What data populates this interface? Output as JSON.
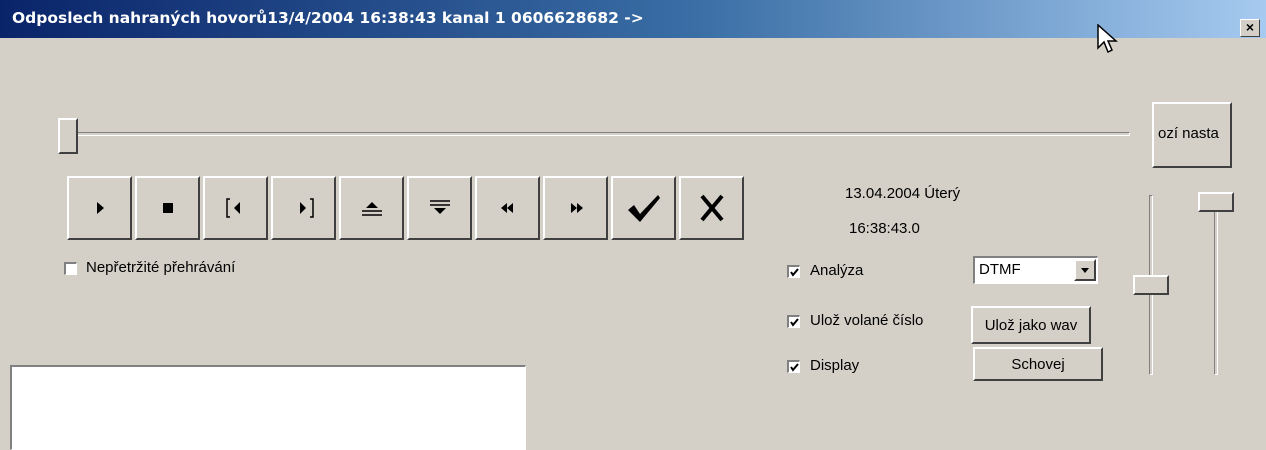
{
  "window": {
    "title": "Odposlech nahraných hovorů13/4/2004 16:38:43 kanal 1 0606628682 ->",
    "close_label": "×"
  },
  "settings_button": {
    "label": "ozí nasta"
  },
  "toolbar": {
    "buttons": [
      {
        "name": "play",
        "icon": "play-icon"
      },
      {
        "name": "stop",
        "icon": "stop-icon"
      },
      {
        "name": "mark-start",
        "icon": "mark-start-icon"
      },
      {
        "name": "mark-end",
        "icon": "mark-end-icon"
      },
      {
        "name": "eject-up",
        "icon": "eject-up-icon"
      },
      {
        "name": "eject-down",
        "icon": "eject-down-icon"
      },
      {
        "name": "rewind",
        "icon": "rewind-icon"
      },
      {
        "name": "fast-forward",
        "icon": "fast-forward-icon"
      },
      {
        "name": "confirm",
        "icon": "checkmark-icon"
      },
      {
        "name": "cancel",
        "icon": "x-icon"
      }
    ]
  },
  "continuous_playback": {
    "label": "Nepřetržité přehrávání",
    "checked": false
  },
  "datetime": {
    "date": "13.04.2004 Úterý",
    "time": "16:38:43.0"
  },
  "options": {
    "analysis": {
      "label": "Analýza",
      "checked": true
    },
    "save_number": {
      "label": "Ulož volané číslo",
      "checked": true
    },
    "display": {
      "label": "Display",
      "checked": true
    }
  },
  "analysis_mode": {
    "value": "DTMF"
  },
  "buttons": {
    "save_wav": "Ulož jako wav",
    "hide": "Schovej"
  },
  "position_slider": {
    "value": 0
  },
  "volume_sliders": [
    {
      "level": 0.53
    },
    {
      "level": 1.0
    }
  ]
}
